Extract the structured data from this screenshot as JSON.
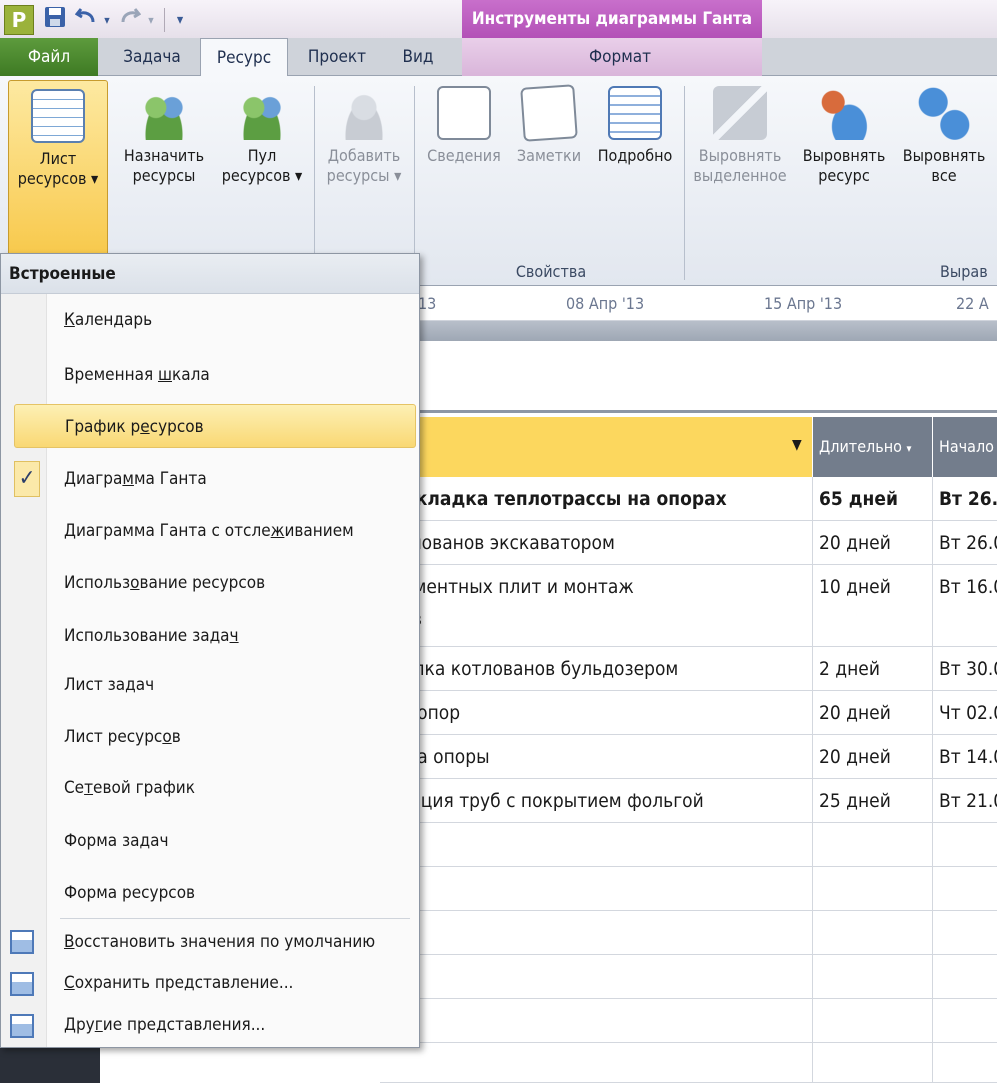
{
  "title_bar": {
    "app_icon": "P",
    "context_tab_group": "Инструменты диаграммы Ганта",
    "qat_icons": [
      "save-icon",
      "undo-icon",
      "redo-icon",
      "customize-icon"
    ]
  },
  "tabs": [
    {
      "label": "Файл"
    },
    {
      "label": "Задача"
    },
    {
      "label": "Ресурс",
      "active": true
    },
    {
      "label": "Проект"
    },
    {
      "label": "Вид"
    },
    {
      "label": "Формат"
    }
  ],
  "ribbon": {
    "resource_sheet": {
      "line1": "Лист",
      "line2": "ресурсов ▾"
    },
    "assign": {
      "line1": "Назначить",
      "line2": "ресурсы"
    },
    "pool": {
      "line1": "Пул",
      "line2": "ресурсов ▾"
    },
    "add": {
      "line1": "Добавить",
      "line2": "ресурсы ▾"
    },
    "info": {
      "line1": "Сведения"
    },
    "notes": {
      "line1": "Заметки"
    },
    "details": {
      "line1": "Подробно"
    },
    "level_sel": {
      "line1": "Выровнять",
      "line2": "выделенное"
    },
    "level_res": {
      "line1": "Выровнять",
      "line2": "ресурс"
    },
    "level_all": {
      "line1": "Выровнять",
      "line2": "все"
    },
    "group_properties": "Свойства",
    "group_level": "Вырав"
  },
  "timeline": {
    "t0": "'13",
    "t1": "08 Апр '13",
    "t2": "15 Апр '13",
    "t3": "22 А"
  },
  "grid": {
    "headers": {
      "duration": "Длительно",
      "start": "Начало"
    },
    "rows": [
      {
        "name": "прокладка теплотрассы на опорах",
        "dur": "65 дней",
        "start": "Вт 26.0",
        "bold": true
      },
      {
        "name": "котлованов экскаватором",
        "dur": "20 дней",
        "start": "Вт 26.0"
      },
      {
        "name": "ндаментных плит и монтаж",
        "name2": "иков",
        "dur": "10 дней",
        "start": "Вт 16.0"
      },
      {
        "name": "асыпка котлованов бульдозером",
        "dur": "2 дней",
        "start": "Вт 30.0"
      },
      {
        "name": "ж/б опор",
        "dur": "20 дней",
        "start": "Чт 02.0"
      },
      {
        "name": "уб на опоры",
        "dur": "20 дней",
        "start": "Вт 14.0"
      },
      {
        "name": "золяция труб с покрытием фольгой",
        "dur": "25 дней",
        "start": "Вт 21.0"
      }
    ]
  },
  "menu": {
    "header": "Встроенные",
    "items": [
      {
        "pre": "",
        "u": "К",
        "post": "алендарь"
      },
      {
        "pre": "Временная ",
        "u": "ш",
        "post": "кала"
      },
      {
        "pre": "График р",
        "u": "е",
        "post": "сурсов",
        "highlight": true
      },
      {
        "pre": "Диагра",
        "u": "м",
        "post": "ма Ганта",
        "checked": true
      },
      {
        "pre": "Диаграмма Ганта с отсле",
        "u": "ж",
        "post": "иванием"
      },
      {
        "pre": "Использ",
        "u": "о",
        "post": "вание ресурсов"
      },
      {
        "pre": "Использование зада",
        "u": "ч",
        "post": ""
      },
      {
        "pre": "Лист задач",
        "u": "",
        "post": ""
      },
      {
        "pre": "Лист ресурс",
        "u": "о",
        "post": "в"
      },
      {
        "pre": "Се",
        "u": "т",
        "post": "евой график"
      },
      {
        "pre": "Форма задач",
        "u": "",
        "post": ""
      },
      {
        "pre": "Форма ресурсов",
        "u": "",
        "post": ""
      }
    ],
    "actions": [
      {
        "pre": "",
        "u": "В",
        "post": "осстановить значения по умолчанию"
      },
      {
        "pre": "",
        "u": "С",
        "post": "охранить представление..."
      },
      {
        "pre": "Дру",
        "u": "г",
        "post": "ие представления..."
      }
    ],
    "check_mark": "✓"
  }
}
